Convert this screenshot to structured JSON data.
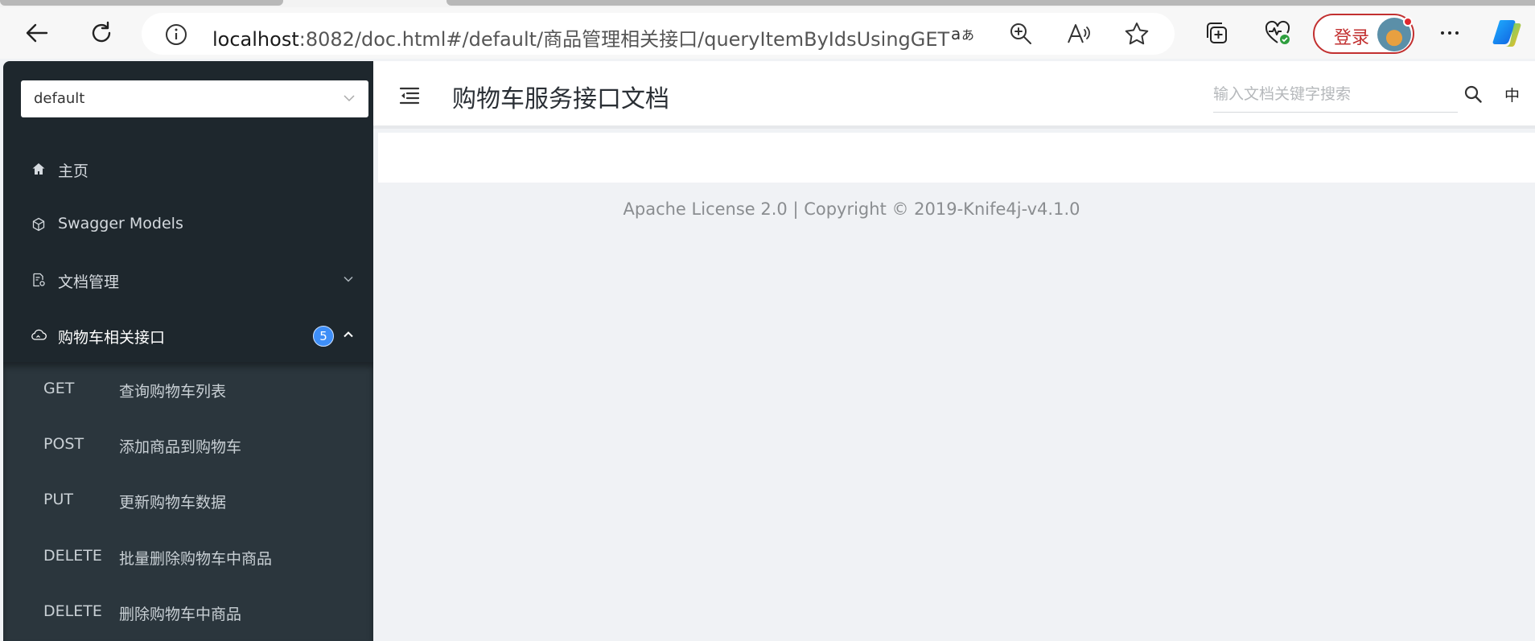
{
  "browser": {
    "url_host": "localhost",
    "url_rest": ":8082/doc.html#/default/商品管理相关接口/queryItemByIdsUsingGET",
    "login_label": "登录"
  },
  "sidebar": {
    "group_value": "default",
    "items": [
      {
        "label": "主页",
        "icon": "home-icon"
      },
      {
        "label": "Swagger Models",
        "icon": "models-icon"
      },
      {
        "label": "文档管理",
        "icon": "doc-settings-icon"
      },
      {
        "label": "购物车相关接口",
        "icon": "cloud-icon",
        "badge": "5"
      }
    ],
    "apis": [
      {
        "method": "GET",
        "label": "查询购物车列表"
      },
      {
        "method": "POST",
        "label": "添加商品到购物车"
      },
      {
        "method": "PUT",
        "label": "更新购物车数据"
      },
      {
        "method": "DELETE",
        "label": "批量删除购物车中商品"
      },
      {
        "method": "DELETE",
        "label": "删除购物车中商品"
      }
    ]
  },
  "header": {
    "title": "购物车服务接口文档",
    "search_placeholder": "输入文档关键字搜索",
    "lang": "中"
  },
  "footer": {
    "text": "Apache License 2.0 | Copyright © 2019-Knife4j-v4.1.0"
  },
  "colors": {
    "sidebar_bg": "#1e272d",
    "submenu_bg": "#2b363d",
    "badge": "#3e8ef7",
    "login_red": "#c23030"
  }
}
